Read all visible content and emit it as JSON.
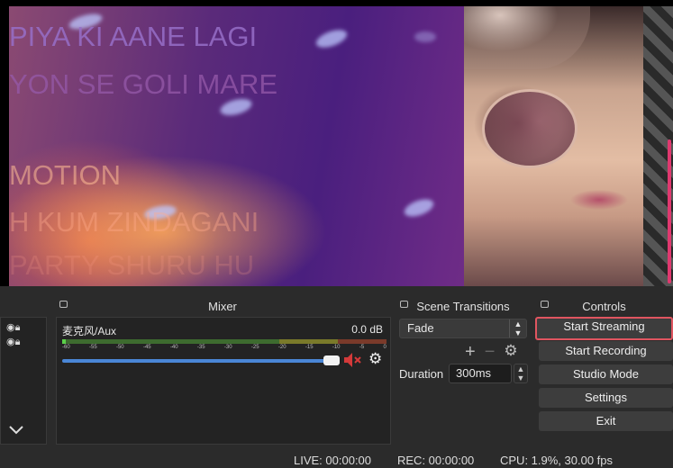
{
  "preview": {
    "lyrics": [
      "PIYA KI AANE LAGI",
      "YON SE GOLI MARE",
      "MOTION",
      "H KUM ZINDAGANI",
      "PARTY SHURU HU"
    ]
  },
  "mixer": {
    "title": "Mixer",
    "channel": {
      "name": "麦克风/Aux",
      "level": "0.0 dB"
    },
    "ticks": [
      "-60",
      "-55",
      "-50",
      "-45",
      "-40",
      "-35",
      "-30",
      "-25",
      "-20",
      "-15",
      "-10",
      "-5",
      "0"
    ]
  },
  "transitions": {
    "title": "Scene Transitions",
    "selected": "Fade",
    "duration_label": "Duration",
    "duration_value": "300ms"
  },
  "controls": {
    "title": "Controls",
    "buttons": [
      "Start Streaming",
      "Start Recording",
      "Studio Mode",
      "Settings",
      "Exit"
    ]
  },
  "status": {
    "live": "LIVE: 00:00:00",
    "rec": "REC: 00:00:00",
    "cpu": "CPU: 1.9%, 30.00 fps"
  },
  "colors": {
    "focus_border": "#e05560",
    "volume_slider": "#4a86d6",
    "mute_icon": "#d43a3a"
  }
}
